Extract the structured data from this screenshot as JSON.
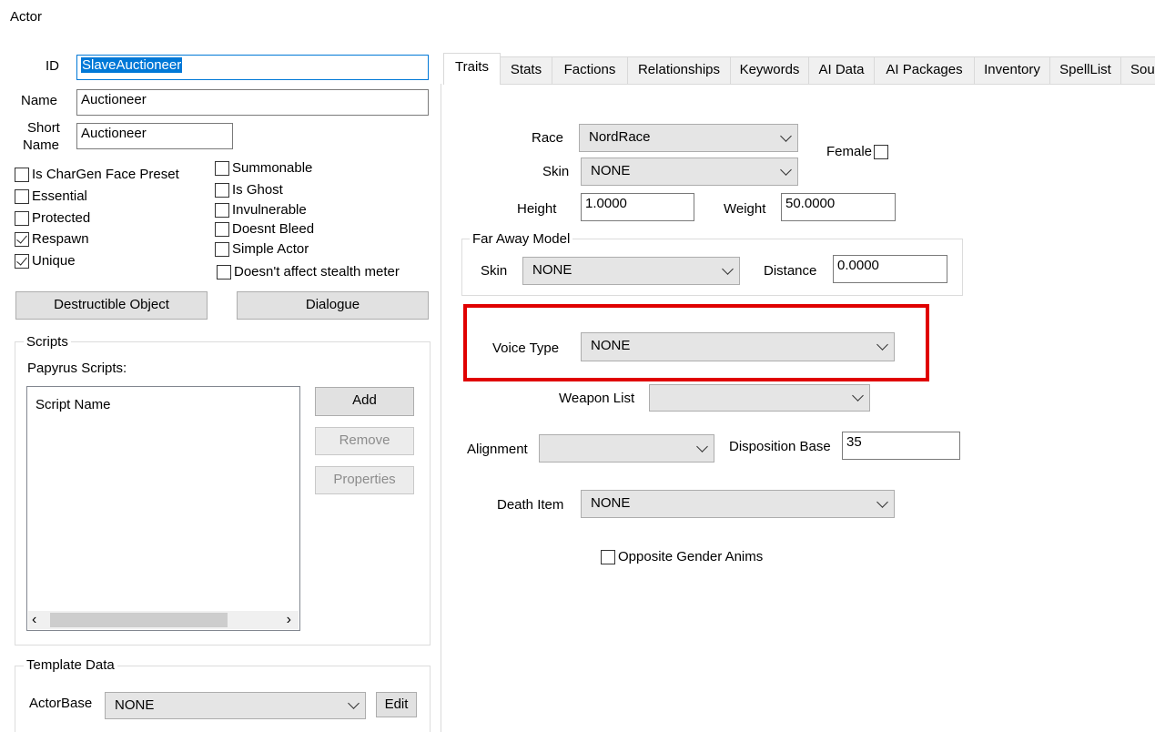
{
  "window": {
    "title": "Actor"
  },
  "left": {
    "id_label": "ID",
    "id_value": "SlaveAuctioneer",
    "name_label": "Name",
    "name_value": "Auctioneer",
    "short_name_label_1": "Short",
    "short_name_label_2": "Name",
    "short_name_value": "Auctioneer",
    "checks_left": [
      {
        "label": "Is CharGen Face Preset",
        "checked": false
      },
      {
        "label": "Essential",
        "checked": false
      },
      {
        "label": "Protected",
        "checked": false
      },
      {
        "label": "Respawn",
        "checked": true
      },
      {
        "label": "Unique",
        "checked": true
      }
    ],
    "checks_right": [
      {
        "label": "Summonable",
        "checked": false
      },
      {
        "label": "Is Ghost",
        "checked": false
      },
      {
        "label": "Invulnerable",
        "checked": false
      },
      {
        "label": "Doesnt Bleed",
        "checked": false
      },
      {
        "label": "Simple Actor",
        "checked": false
      },
      {
        "label": "Doesn't affect stealth meter",
        "checked": false
      }
    ],
    "destructible_button": "Destructible Object",
    "dialogue_button": "Dialogue",
    "scripts": {
      "group_title": "Scripts",
      "papyrus_label": "Papyrus Scripts:",
      "column_header": "Script Name",
      "add_button": "Add",
      "remove_button": "Remove",
      "properties_button": "Properties"
    },
    "template": {
      "group_title": "Template Data",
      "actorbase_label": "ActorBase",
      "actorbase_value": "NONE",
      "edit_button": "Edit"
    }
  },
  "tabs": [
    {
      "label": "Traits",
      "active": true
    },
    {
      "label": "Stats"
    },
    {
      "label": "Factions"
    },
    {
      "label": "Relationships"
    },
    {
      "label": "Keywords"
    },
    {
      "label": "AI Data"
    },
    {
      "label": "AI Packages"
    },
    {
      "label": "Inventory"
    },
    {
      "label": "SpellList"
    },
    {
      "label": "Sou"
    }
  ],
  "traits": {
    "race_label": "Race",
    "race_value": "NordRace",
    "female_label": "Female",
    "skin_label": "Skin",
    "skin_value": "NONE",
    "height_label": "Height",
    "height_value": "1.0000",
    "weight_label": "Weight",
    "weight_value": "50.0000",
    "far_away": {
      "group_title": "Far Away Model",
      "skin_label": "Skin",
      "skin_value": "NONE",
      "distance_label": "Distance",
      "distance_value": "0.0000"
    },
    "voice_type_label": "Voice Type",
    "voice_type_value": "NONE",
    "weapon_list_label": "Weapon List",
    "weapon_list_value": "",
    "alignment_label": "Alignment",
    "alignment_value": "",
    "disposition_label": "Disposition Base",
    "disposition_value": "35",
    "death_item_label": "Death Item",
    "death_item_value": "NONE",
    "opposite_gender_label": "Opposite Gender Anims"
  },
  "colors": {
    "highlight": "#e00000",
    "selection": "#0078d7"
  }
}
